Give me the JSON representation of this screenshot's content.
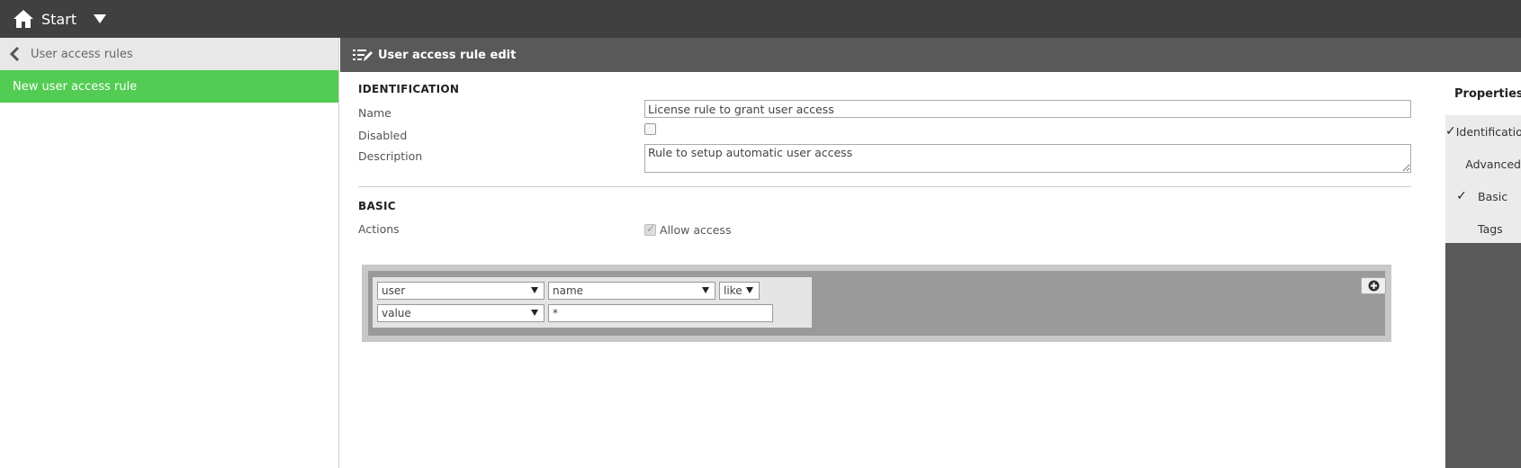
{
  "topbar": {
    "home_label": "Start"
  },
  "left_panel": {
    "back_label": "User access rules",
    "items": [
      {
        "label": "New user access rule",
        "active": true
      }
    ]
  },
  "main": {
    "title": "User access rule edit",
    "identification": {
      "title": "IDENTIFICATION",
      "name_label": "Name",
      "name_value": "License rule to grant user access",
      "disabled_label": "Disabled",
      "disabled_checked": false,
      "description_label": "Description",
      "description_value": "Rule to setup automatic user access"
    },
    "basic": {
      "title": "BASIC",
      "actions_label": "Actions",
      "allow_access_label": "Allow access",
      "allow_access_checked": true,
      "condition": {
        "resource_select": "user",
        "attribute_select": "name",
        "operator_select": "like",
        "value_type_select": "value",
        "value_input": "*"
      }
    }
  },
  "properties": {
    "title": "Properties",
    "items": [
      {
        "label": "Identification",
        "checked": true
      },
      {
        "label": "Advanced",
        "checked": false
      },
      {
        "label": "Basic",
        "checked": true
      },
      {
        "label": "Tags",
        "checked": false
      }
    ]
  },
  "colors": {
    "topbar": "#404040",
    "accent_green": "#52cc52",
    "header": "#595959"
  },
  "icons": {
    "home": "home-icon",
    "dropdown": "caret-down-icon",
    "back": "chevron-left-icon",
    "edit": "list-edit-icon",
    "add": "plus-circle-icon"
  }
}
